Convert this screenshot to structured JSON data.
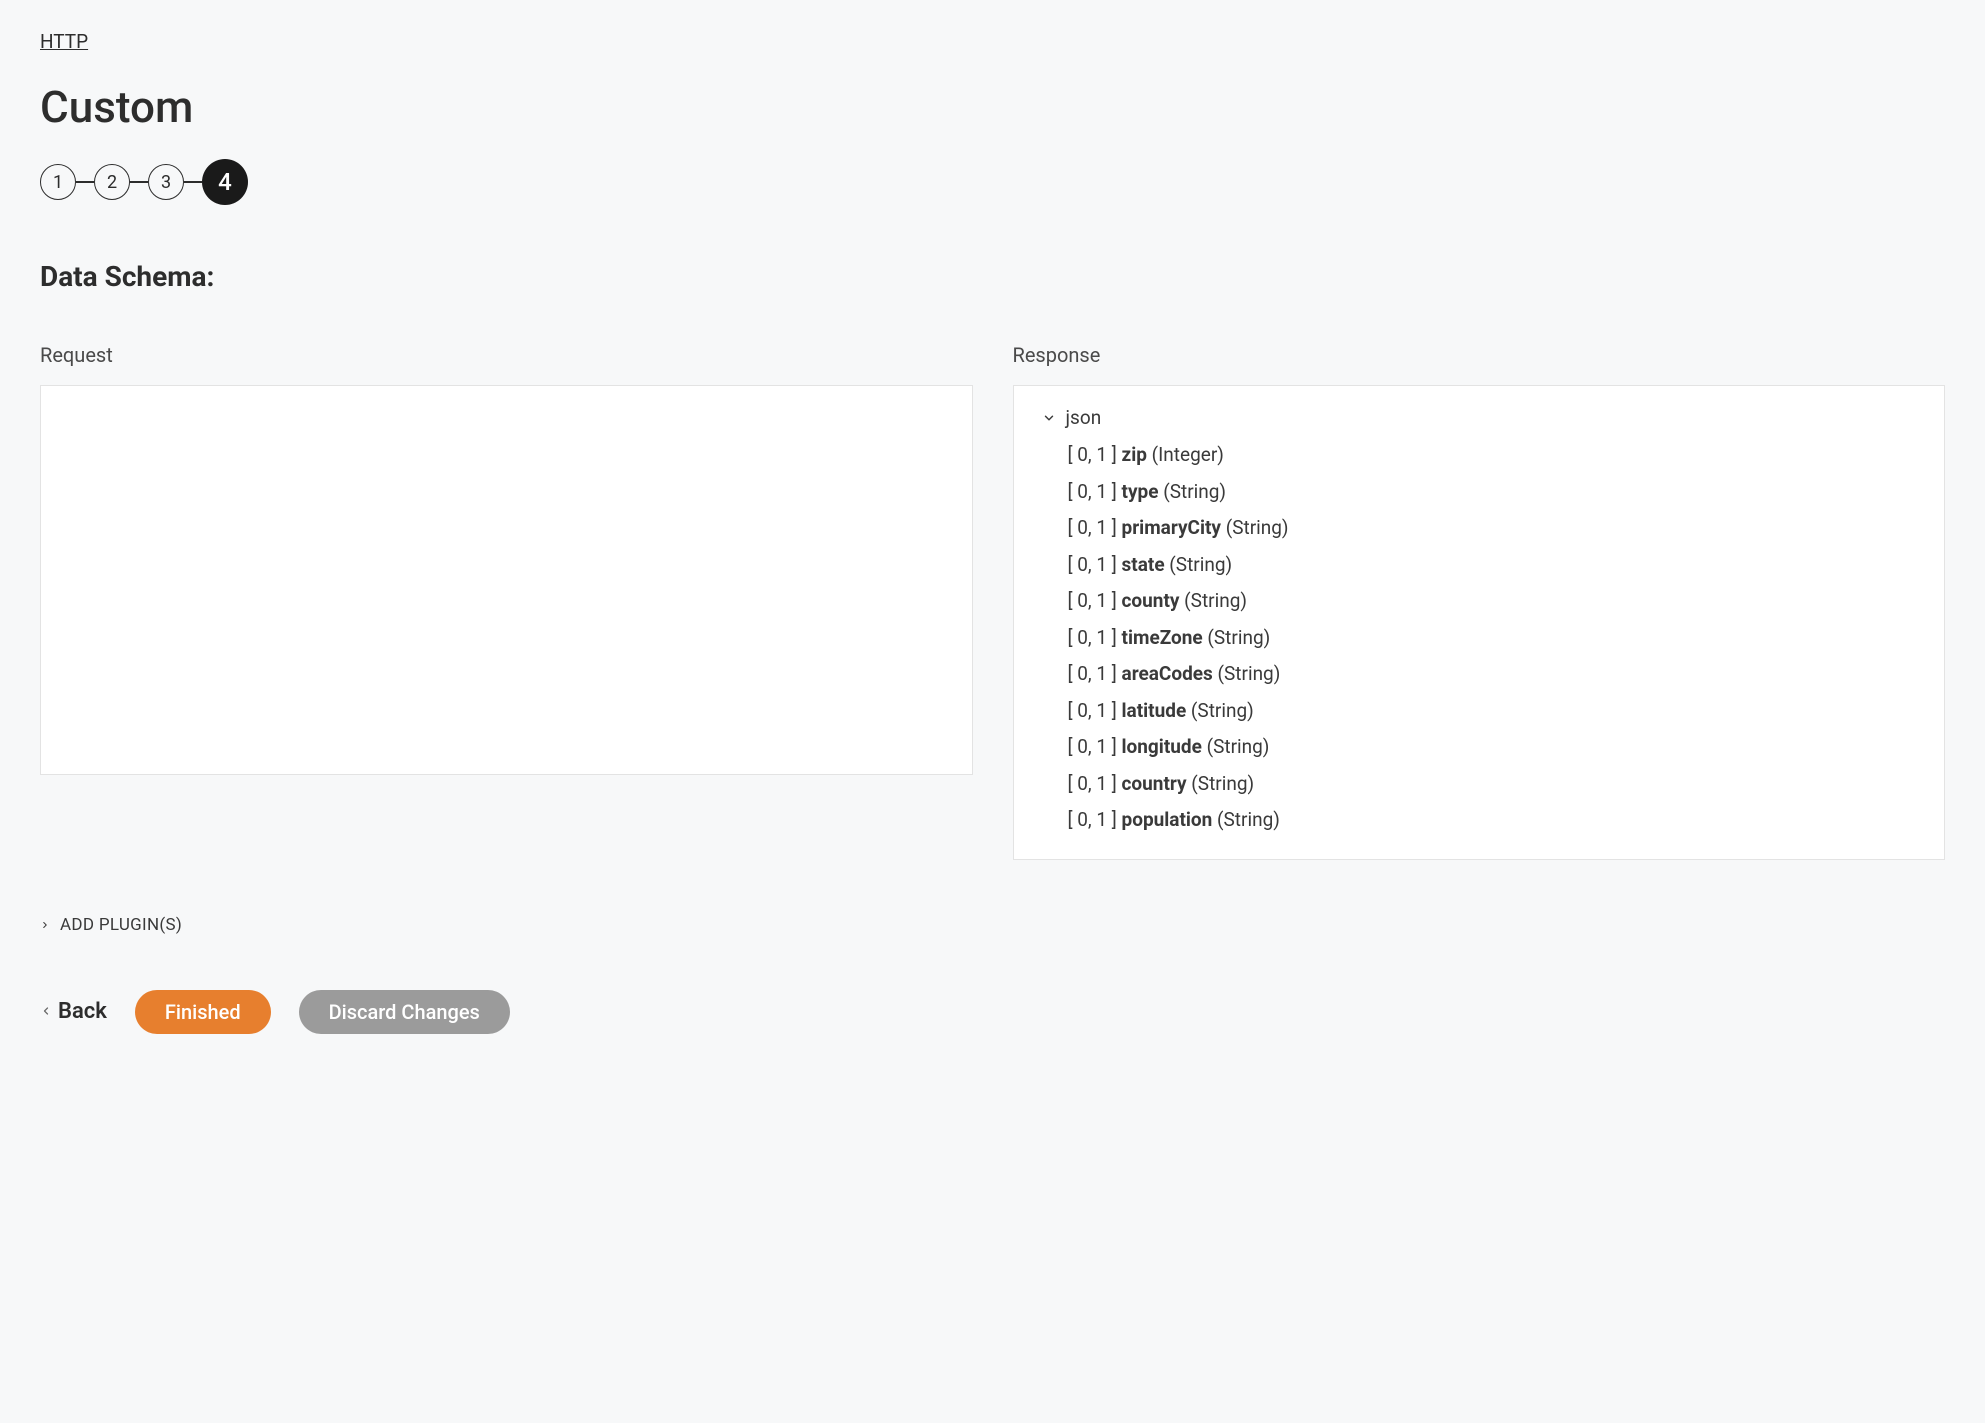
{
  "breadcrumb": "HTTP",
  "title": "Custom",
  "stepper": {
    "steps": [
      "1",
      "2",
      "3",
      "4"
    ],
    "activeIndex": 3
  },
  "sectionTitle": "Data Schema:",
  "requestLabel": "Request",
  "responseLabel": "Response",
  "responseTree": {
    "rootLabel": "json",
    "children": [
      {
        "cardinality": "[ 0, 1 ]",
        "name": "zip",
        "type": "(Integer)"
      },
      {
        "cardinality": "[ 0, 1 ]",
        "name": "type",
        "type": "(String)"
      },
      {
        "cardinality": "[ 0, 1 ]",
        "name": "primaryCity",
        "type": "(String)"
      },
      {
        "cardinality": "[ 0, 1 ]",
        "name": "state",
        "type": "(String)"
      },
      {
        "cardinality": "[ 0, 1 ]",
        "name": "county",
        "type": "(String)"
      },
      {
        "cardinality": "[ 0, 1 ]",
        "name": "timeZone",
        "type": "(String)"
      },
      {
        "cardinality": "[ 0, 1 ]",
        "name": "areaCodes",
        "type": "(String)"
      },
      {
        "cardinality": "[ 0, 1 ]",
        "name": "latitude",
        "type": "(String)"
      },
      {
        "cardinality": "[ 0, 1 ]",
        "name": "longitude",
        "type": "(String)"
      },
      {
        "cardinality": "[ 0, 1 ]",
        "name": "country",
        "type": "(String)"
      },
      {
        "cardinality": "[ 0, 1 ]",
        "name": "population",
        "type": "(String)"
      }
    ]
  },
  "addPluginsLabel": "ADD PLUGIN(S)",
  "buttons": {
    "back": "Back",
    "finished": "Finished",
    "discard": "Discard Changes"
  }
}
